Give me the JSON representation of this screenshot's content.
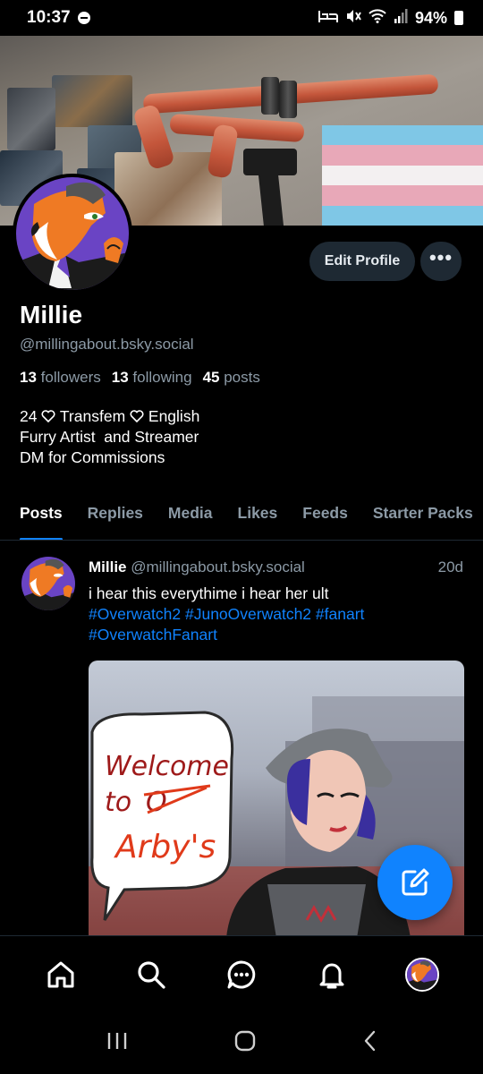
{
  "status_bar": {
    "time": "10:37",
    "battery": "94%"
  },
  "profile": {
    "name": "Millie",
    "handle": "@millingabout.bsky.social",
    "followers_count": "13",
    "followers_label": "followers",
    "following_count": "13",
    "following_label": "following",
    "posts_count": "45",
    "posts_label": "posts",
    "bio_line1_a": "24",
    "bio_line1_b": "Transfem",
    "bio_line1_c": "English",
    "bio_line2": "Furry Artist  and Streamer",
    "bio_line3": "DM for Commissions",
    "edit_button": "Edit Profile",
    "more_button": "•••"
  },
  "tabs": [
    {
      "label": "Posts",
      "active": true
    },
    {
      "label": "Replies",
      "active": false
    },
    {
      "label": "Media",
      "active": false
    },
    {
      "label": "Likes",
      "active": false
    },
    {
      "label": "Feeds",
      "active": false
    },
    {
      "label": "Starter Packs",
      "active": false
    }
  ],
  "post": {
    "author": "Millie",
    "handle": "@millingabout.bsky.social",
    "time": "20d",
    "text": "i hear this everythime i hear her ult",
    "tags": [
      "#Overwatch2",
      "#JunoOverwatch2",
      "#fanart",
      "#OverwatchFanart"
    ],
    "image_text": [
      "Welcome",
      "to",
      "O",
      "Arby's"
    ]
  },
  "bottom_nav": {
    "items": [
      "home-icon",
      "search-icon",
      "chat-icon",
      "bell-icon",
      "profile-avatar"
    ]
  },
  "colors": {
    "accent": "#1083fe",
    "muted": "#8c9aa6",
    "button_bg": "#1e2933",
    "background": "#000000"
  }
}
